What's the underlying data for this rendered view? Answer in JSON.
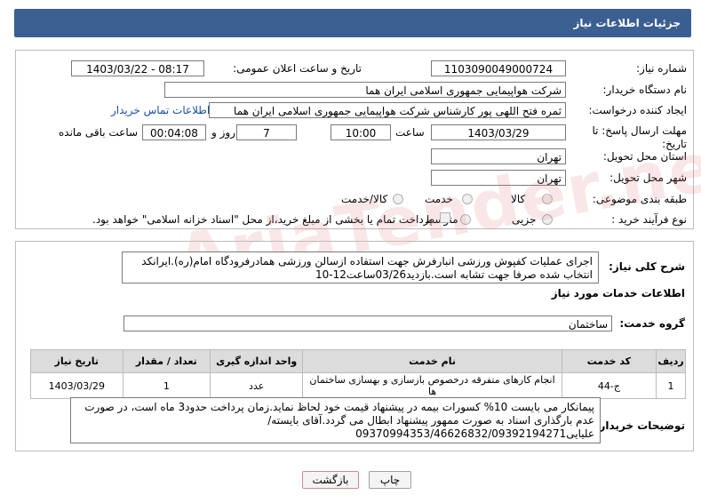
{
  "header": {
    "title": "جزئیات اطلاعات نیاز"
  },
  "form": {
    "need_number_label": "شماره نیاز:",
    "need_number": "1103090049000724",
    "announce_label": "تاریخ و ساعت اعلان عمومی:",
    "announce_value": "1403/03/22 - 08:17",
    "buyer_org_label": "نام دستگاه خریدار:",
    "buyer_org": "شرکت هواپیمایی جمهوری اسلامی ایران هما",
    "requester_label": "ایجاد کننده درخواست:",
    "requester": "ثمره فتح اللهی پور کارشناس شرکت هواپیمایی جمهوری اسلامی ایران هما",
    "contact_link": "اطلاعات تماس خریدار",
    "deadline_label": "مهلت ارسال پاسخ: تا تاریخ:",
    "deadline_date": "1403/03/29",
    "time_label": "ساعت",
    "deadline_time": "10:00",
    "days_value": "7",
    "days_label": "روز و",
    "remaining_time": "00:04:08",
    "remaining_label": "ساعت باقی مانده",
    "province_label": "استان محل تحویل:",
    "province": "تهران",
    "city_label": "شهر محل تحویل:",
    "city": "تهران",
    "category_label": "طبقه بندی موضوعی:",
    "category_options": [
      "کالا",
      "خدمت",
      "کالا/خدمت"
    ],
    "process_label": "نوع فرآیند خرید :",
    "process_options": [
      "جزیی",
      "متوسط"
    ],
    "payment_note": "پرداخت تمام یا بخشی از مبلغ خرید،از محل \"اسناد خزانه اسلامی\" خواهد بود."
  },
  "summary": {
    "label": "شرح کلی نیاز:",
    "text": "اجرای عملیات کفپوش ورزشی انبارفرش جهت استفاده ازسالن ورزشی همادرفرودگاه امام(ره).ایرانکد انتخاب شده صرفا جهت تشابه است.بازدید03/26ساعت12-10"
  },
  "services": {
    "section_title": "اطلاعات خدمات مورد نیاز",
    "group_label": "گروه خدمت:",
    "group_value": "ساختمان",
    "columns": [
      "ردیف",
      "کد خدمت",
      "نام خدمت",
      "واحد اندازه گیری",
      "تعداد / مقدار",
      "تاریخ نیاز"
    ],
    "rows": [
      [
        "1",
        "ج-44",
        "انجام کارهای متفرقه درخصوص بازسازی و بهسازی ساختمان ها",
        "عدد",
        "1",
        "1403/03/29"
      ]
    ]
  },
  "buyer_notes": {
    "label": "توضیحات خریدار:",
    "text": "پیمانکار می بایست 10% کسورات بیمه در پیشنهاد قیمت خود لحاظ نماید.زمان پرداخت حدود3 ماه است، در صورت عدم بارگذاری اسناد به صورت ممهور پیشنهاد ابطال می گردد.آقای بایسته/علیایی09370994353/46626832/09392194271"
  },
  "buttons": {
    "print": "چاپ",
    "back": "بازگشت"
  },
  "colors": {
    "header": "#3c5f92",
    "link": "#1a4fa6",
    "table_header": "#dcdcdc"
  }
}
